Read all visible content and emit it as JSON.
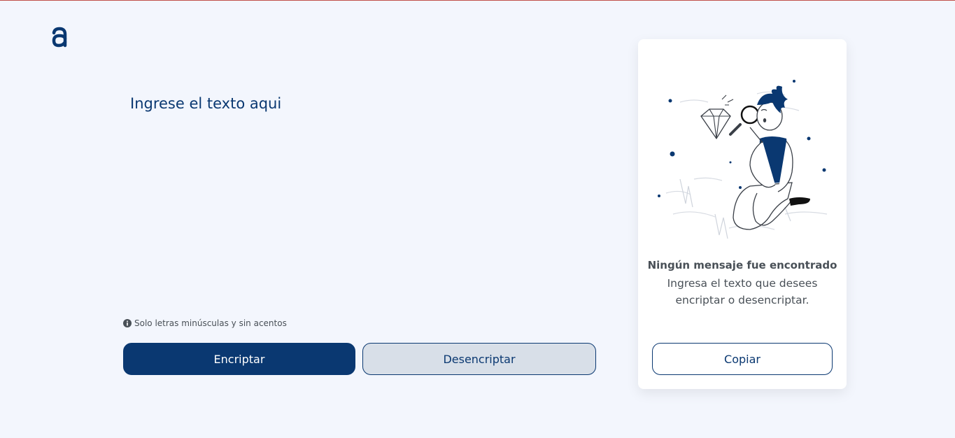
{
  "logo": {
    "icon": "alura-logo-icon"
  },
  "editor": {
    "placeholder": "Ingrese el texto aqui",
    "value": ""
  },
  "hint": {
    "icon": "info-icon",
    "text": "Solo letras minúsculas y sin acentos"
  },
  "actions": {
    "encrypt_label": "Encriptar",
    "decrypt_label": "Desencriptar"
  },
  "result_panel": {
    "illustration": "person-with-magnifying-glass-illustration",
    "title": "Ningún mensaje fue encontrado",
    "message": "Ingresa el texto que desees encriptar o desencriptar.",
    "copy_label": "Copiar"
  },
  "colors": {
    "background": "#f3f6fd",
    "primary": "#0a3871",
    "secondary_button": "#d8dfe8",
    "text_muted": "#495057",
    "card": "#ffffff"
  }
}
